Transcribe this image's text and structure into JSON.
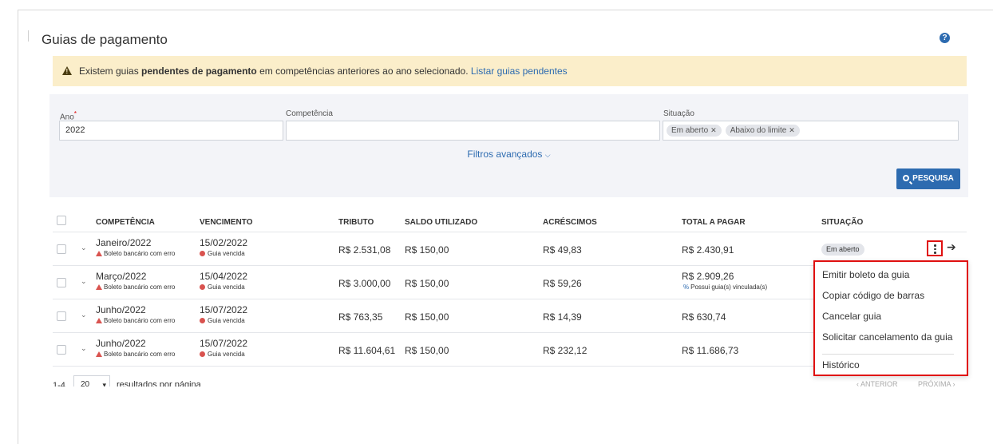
{
  "page": {
    "title": "Guias de pagamento"
  },
  "alert": {
    "prefix": "Existem guias ",
    "bold": "pendentes de pagamento",
    "suffix": " em competências anteriores ao ano selecionado. ",
    "link": "Listar guias pendentes"
  },
  "filters": {
    "ano_label": "Ano",
    "ano_value": "2022",
    "competencia_label": "Competência",
    "competencia_value": "",
    "situacao_label": "Situação",
    "situacao_chips": [
      "Em aberto",
      "Abaixo do limite"
    ],
    "advanced_label": "Filtros avançados",
    "search_label": "PESQUISA"
  },
  "table": {
    "headers": [
      "COMPETÊNCIA",
      "VENCIMENTO",
      "TRIBUTO",
      "SALDO UTILIZADO",
      "ACRÉSCIMOS",
      "TOTAL A PAGAR",
      "SITUAÇÃO"
    ],
    "rows": [
      {
        "competencia": "Janeiro/2022",
        "erro": "Boleto bancário com erro",
        "vencimento": "15/02/2022",
        "vencida": "Guia vencida",
        "tributo": "R$ 2.531,08",
        "saldo": "R$ 150,00",
        "acrescimos": "R$ 49,83",
        "total": "R$ 2.430,91",
        "total_note": "",
        "situacao": "Em aberto"
      },
      {
        "competencia": "Março/2022",
        "erro": "Boleto bancário com erro",
        "vencimento": "15/04/2022",
        "vencida": "Guia vencida",
        "tributo": "R$ 3.000,00",
        "saldo": "R$ 150,00",
        "acrescimos": "R$ 59,26",
        "total": "R$ 2.909,26",
        "total_note": "Possui guia(s) vinculada(s)",
        "situacao": ""
      },
      {
        "competencia": "Junho/2022",
        "erro": "Boleto bancário com erro",
        "vencimento": "15/07/2022",
        "vencida": "Guia vencida",
        "tributo": "R$ 763,35",
        "saldo": "R$ 150,00",
        "acrescimos": "R$ 14,39",
        "total": "R$ 630,74",
        "total_note": "",
        "situacao": ""
      },
      {
        "competencia": "Junho/2022",
        "erro": "Boleto bancário com erro",
        "vencimento": "15/07/2022",
        "vencida": "Guia vencida",
        "tributo": "R$ 11.604,61",
        "saldo": "R$ 150,00",
        "acrescimos": "R$ 232,12",
        "total": "R$ 11.686,73",
        "total_note": "",
        "situacao": ""
      }
    ]
  },
  "menu": {
    "items": [
      "Emitir boleto da guia",
      "Copiar código de barras",
      "Cancelar guia",
      "Solicitar cancelamento da guia",
      "Histórico"
    ]
  },
  "footer": {
    "count": "1-4",
    "per_page": "20",
    "per_page_label": "resultados por página",
    "prev": "‹ ANTERIOR",
    "next": "PRÓXIMA ›"
  },
  "colors": {
    "accent": "#2d6bb0",
    "alert_bg": "#fbeeca",
    "highlight": "#e01010",
    "error": "#d9534f"
  }
}
